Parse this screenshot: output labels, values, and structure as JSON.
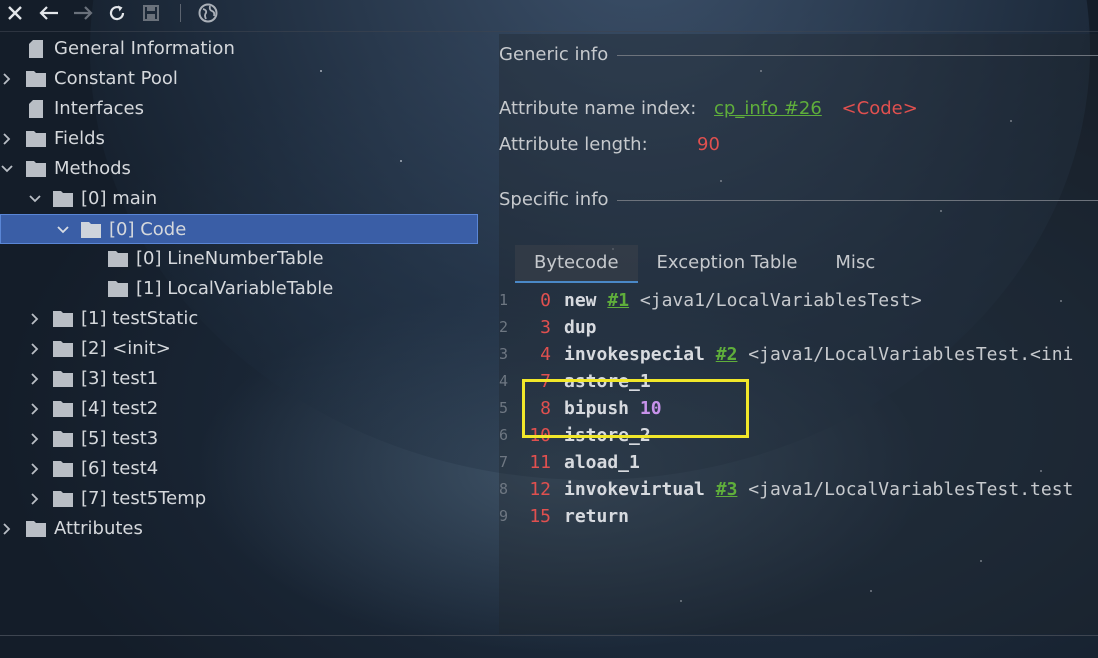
{
  "toolbar": {
    "buttons": [
      "close-icon",
      "back-icon",
      "forward-icon",
      "refresh-icon",
      "save-icon",
      "globe-icon"
    ]
  },
  "tree": {
    "general": "General Information",
    "constant_pool": "Constant Pool",
    "interfaces": "Interfaces",
    "fields": "Fields",
    "methods": "Methods",
    "main": "[0] main",
    "code": "[0] Code",
    "line_number_table": "[0] LineNumberTable",
    "local_variable_table": "[1] LocalVariableTable",
    "test_static": "[1] testStatic",
    "init": "[2] <init>",
    "test1": "[3] test1",
    "test2": "[4] test2",
    "test3": "[5] test3",
    "test4": "[6] test4",
    "test5temp": "[7] test5Temp",
    "attributes": "Attributes"
  },
  "panel": {
    "generic_info": "Generic info",
    "attr_name_index_label": "Attribute name index:",
    "attr_name_index_link": "cp_info #26",
    "attr_name_index_value": "<Code>",
    "attr_length_label": "Attribute length:",
    "attr_length_value": "90",
    "specific_info": "Specific info",
    "tabs": [
      "Bytecode",
      "Exception Table",
      "Misc"
    ]
  },
  "bytecode": [
    {
      "line": "1",
      "offset": "0",
      "op": "new",
      "ref": "#1",
      "comment": "<java1/LocalVariablesTest>"
    },
    {
      "line": "2",
      "offset": "3",
      "op": "dup"
    },
    {
      "line": "3",
      "offset": "4",
      "op": "invokespecial",
      "ref": "#2",
      "comment": "<java1/LocalVariablesTest.<ini"
    },
    {
      "line": "4",
      "offset": "7",
      "op": "astore_1"
    },
    {
      "line": "5",
      "offset": "8",
      "op": "bipush",
      "arg": "10"
    },
    {
      "line": "6",
      "offset": "10",
      "op": "istore_2"
    },
    {
      "line": "7",
      "offset": "11",
      "op": "aload_1"
    },
    {
      "line": "8",
      "offset": "12",
      "op": "invokevirtual",
      "ref": "#3",
      "comment": "<java1/LocalVariablesTest.test"
    },
    {
      "line": "9",
      "offset": "15",
      "op": "return"
    }
  ],
  "colors": {
    "selection": "#3a5ea6",
    "offset": "#e0504f",
    "link": "#5fae3b",
    "literal": "#c792ea",
    "highlight_box": "#f1e72a"
  }
}
